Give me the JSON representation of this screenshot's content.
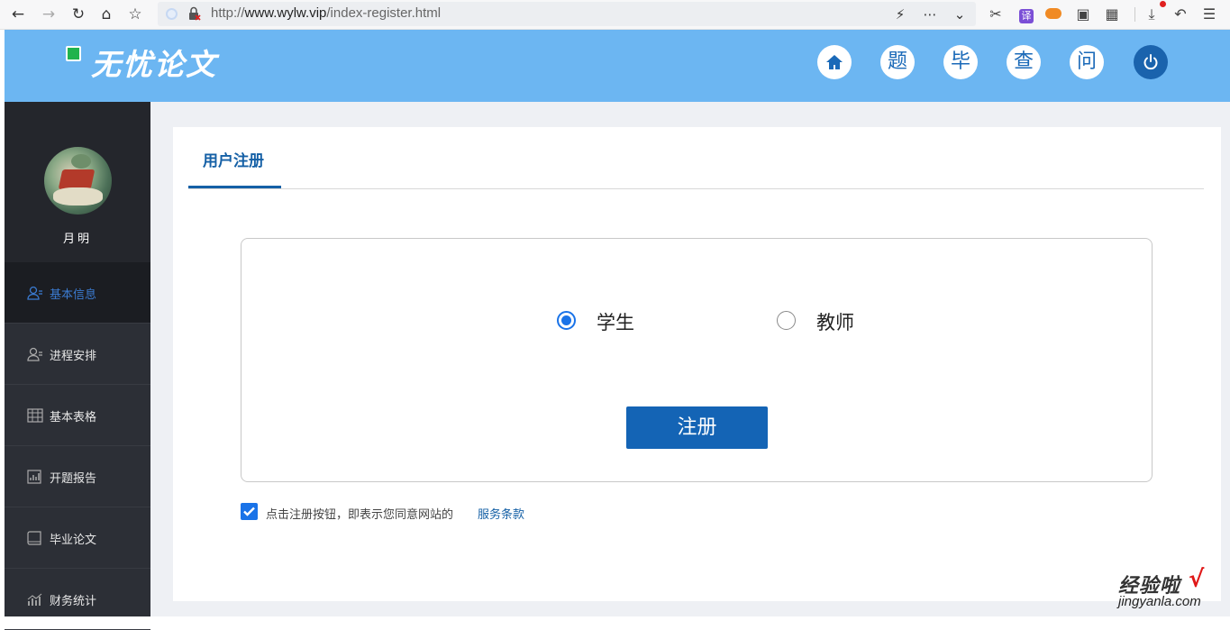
{
  "browser": {
    "url_prefix": "http://",
    "url_domain": "www.wylw.vip",
    "url_path": "/index-register.html"
  },
  "header": {
    "logo_text": "无忧论文",
    "nav": [
      {
        "icon": "home-icon",
        "label": ""
      },
      {
        "label": "题"
      },
      {
        "label": "毕"
      },
      {
        "label": "查"
      },
      {
        "label": "问"
      },
      {
        "icon": "power-icon",
        "label": ""
      }
    ]
  },
  "sidebar": {
    "username": "月明",
    "items": [
      {
        "label": "基本信息",
        "icon": "user-icon",
        "active": true
      },
      {
        "label": "进程安排",
        "icon": "user-icon",
        "active": false
      },
      {
        "label": "基本表格",
        "icon": "table-icon",
        "active": false
      },
      {
        "label": "开题报告",
        "icon": "report-icon",
        "active": false
      },
      {
        "label": "毕业论文",
        "icon": "book-icon",
        "active": false
      },
      {
        "label": "财务统计",
        "icon": "chart-icon",
        "active": false
      }
    ]
  },
  "main": {
    "tab_title": "用户注册",
    "roles": [
      {
        "label": "学生",
        "checked": true
      },
      {
        "label": "教师",
        "checked": false
      }
    ],
    "register_label": "注册",
    "agree_text": "点击注册按钮，即表示您同意网站的",
    "terms_link": "服务条款",
    "agree_checked": true
  },
  "watermark": {
    "title": "经验啦",
    "check": "√",
    "url": "jingyanla.com"
  },
  "colors": {
    "header_bg": "#6cb6f2",
    "sidebar_bg": "#2c2f36",
    "accent": "#1464b5",
    "radio_accent": "#1a73e8"
  }
}
